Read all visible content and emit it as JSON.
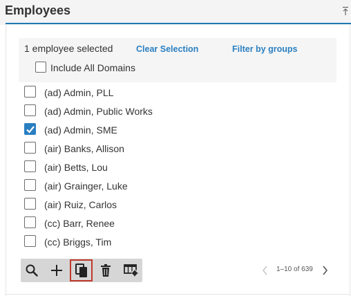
{
  "panel": {
    "title": "Employees"
  },
  "selection": {
    "count_text": "1 employee selected",
    "clear_label": "Clear Selection",
    "filter_label": "Filter by groups",
    "include_domains_label": "Include All Domains",
    "include_domains_checked": false
  },
  "employees": [
    {
      "name": "(ad) Admin, PLL",
      "checked": false
    },
    {
      "name": "(ad) Admin, Public Works",
      "checked": false
    },
    {
      "name": "(ad) Admin, SME",
      "checked": true
    },
    {
      "name": "(air) Banks, Allison",
      "checked": false
    },
    {
      "name": "(air) Betts, Lou",
      "checked": false
    },
    {
      "name": "(air) Grainger, Luke",
      "checked": false
    },
    {
      "name": "(air) Ruiz, Carlos",
      "checked": false
    },
    {
      "name": "(cc) Barr, Renee",
      "checked": false
    },
    {
      "name": "(cc) Briggs, Tim",
      "checked": false
    }
  ],
  "toolbar": {
    "buttons": [
      "search-icon",
      "add-icon",
      "copy-icon",
      "trash-icon",
      "settings-table-icon"
    ],
    "active_button": "copy-icon"
  },
  "pager": {
    "range_text": "1–10 of 639"
  },
  "colors": {
    "accent": "#2a7fc1",
    "rule": "#1f78b4",
    "active_outline": "#c0392b",
    "toolbar_bg": "#d6d6d6"
  }
}
